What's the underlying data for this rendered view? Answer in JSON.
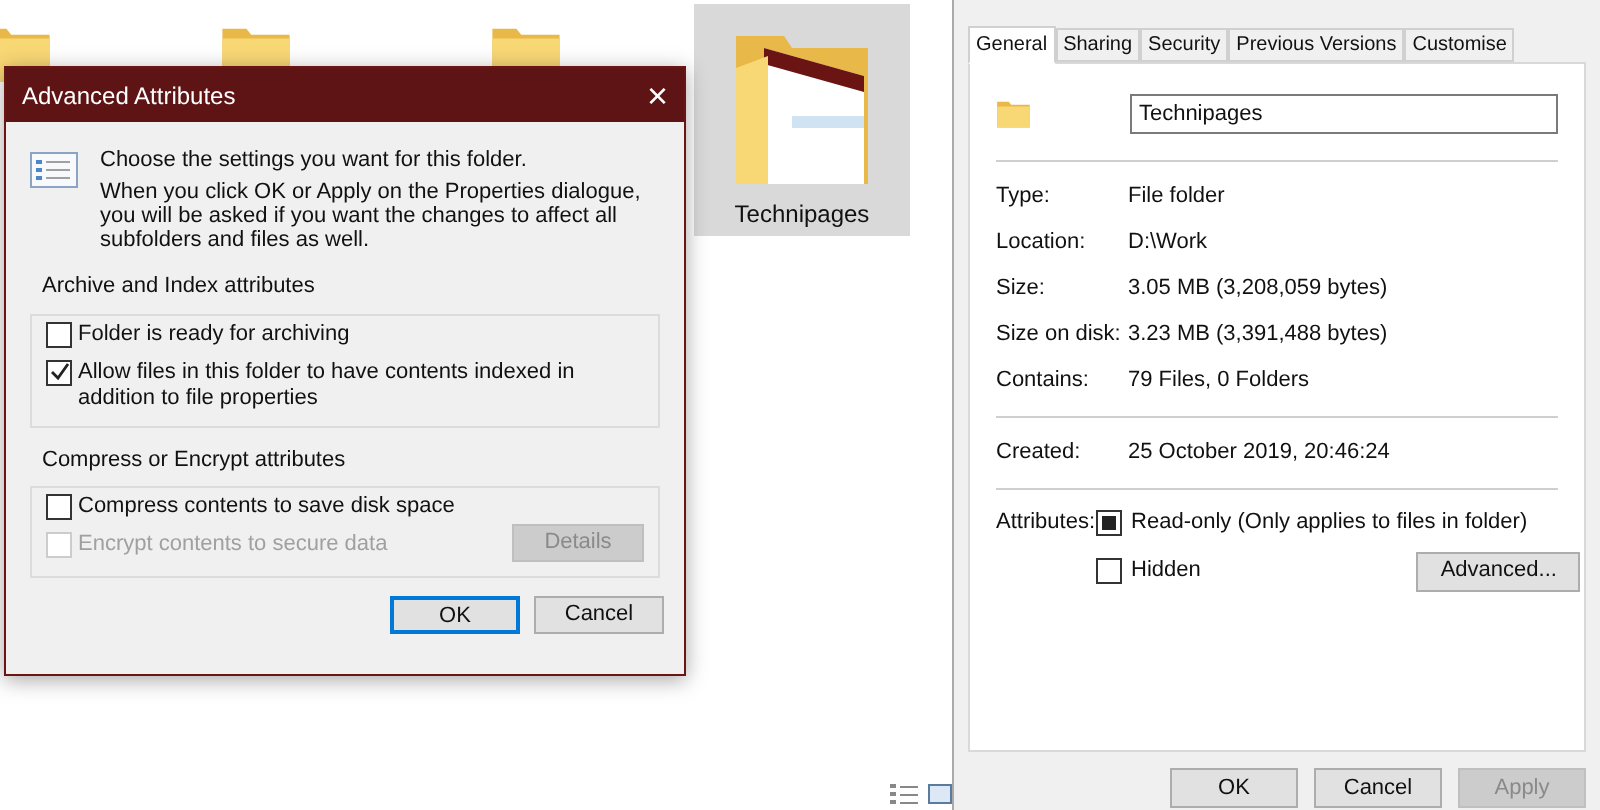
{
  "explorer": {
    "items": [
      {
        "label": "Technipages",
        "selected": true
      }
    ]
  },
  "dialog": {
    "title": "Advanced Attributes",
    "close": "×",
    "intro": "Choose the settings you want for this folder.",
    "description": "When you click OK or Apply on the Properties dialogue, you will be asked if you want the changes to affect all subfolders and files as well.",
    "groups": [
      {
        "title": "Archive and Index attributes",
        "options": [
          {
            "label": "Folder is ready for archiving",
            "checked": false,
            "disabled": false
          },
          {
            "label": "Allow files in this folder to have contents indexed in addition to file properties",
            "checked": true,
            "disabled": false
          }
        ]
      },
      {
        "title": "Compress or Encrypt attributes",
        "options": [
          {
            "label": "Compress contents to save disk space",
            "checked": false,
            "disabled": false
          },
          {
            "label": "Encrypt contents to secure data",
            "checked": false,
            "disabled": true
          }
        ],
        "button": {
          "label": "Details",
          "disabled": true
        }
      }
    ],
    "buttons": [
      {
        "label": "OK",
        "default": true
      },
      {
        "label": "Cancel",
        "default": false
      }
    ]
  },
  "properties": {
    "tabs": [
      {
        "label": "General",
        "selected": true
      },
      {
        "label": "Sharing",
        "selected": false
      },
      {
        "label": "Security",
        "selected": false
      },
      {
        "label": "Previous Versions",
        "selected": false
      },
      {
        "label": "Customise",
        "selected": false
      }
    ],
    "name": "Technipages",
    "sections": [
      [
        {
          "label": "Type:",
          "value": "File folder"
        },
        {
          "label": "Location:",
          "value": "D:\\Work"
        },
        {
          "label": "Size:",
          "value": "3.05 MB (3,208,059 bytes)"
        },
        {
          "label": "Size on disk:",
          "value": "3.23 MB (3,391,488 bytes)"
        },
        {
          "label": "Contains:",
          "value": "79 Files, 0 Folders"
        }
      ],
      [
        {
          "label": "Created:",
          "value": "25 October 2019, 20:46:24"
        }
      ]
    ],
    "attributes": {
      "label": "Attributes:",
      "options": [
        {
          "label": "Read-only (Only applies to files in folder)",
          "checked": false,
          "indeterminate": true
        },
        {
          "label": "Hidden",
          "checked": false,
          "indeterminate": false
        }
      ],
      "button": "Advanced..."
    },
    "buttons": [
      {
        "label": "OK",
        "disabled": false
      },
      {
        "label": "Cancel",
        "disabled": false
      },
      {
        "label": "Apply",
        "disabled": true
      }
    ]
  }
}
